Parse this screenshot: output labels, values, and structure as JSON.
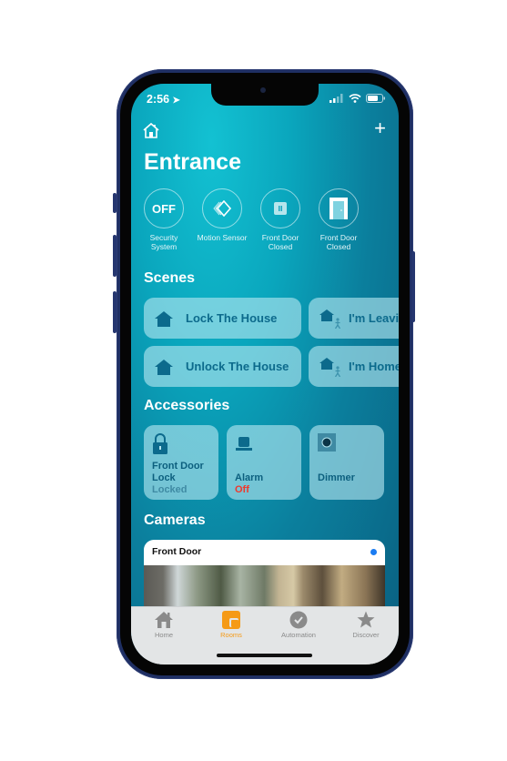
{
  "status_bar": {
    "time": "2:56"
  },
  "header": {
    "title": "Entrance",
    "home_icon": "house-outline-icon",
    "add_icon": "plus-icon"
  },
  "status_items": [
    {
      "icon_text": "OFF",
      "label_line1": "Security",
      "label_line2": "System"
    },
    {
      "icon": "motion-sensor-icon",
      "label_line1": "Motion Sensor",
      "label_line2": ""
    },
    {
      "icon": "door-closed-small-icon",
      "label_line1": "Front Door",
      "label_line2": "Closed"
    },
    {
      "icon": "door-closed-icon",
      "label_line1": "Front Door",
      "label_line2": "Closed"
    }
  ],
  "scenes": {
    "title": "Scenes",
    "items": [
      {
        "label": "Lock The House",
        "icon": "house-icon"
      },
      {
        "label": "I'm Leaving",
        "icon": "house-person-icon"
      },
      {
        "label": "Unlock The House",
        "icon": "house-icon"
      },
      {
        "label": "I'm Home",
        "icon": "house-person-icon"
      }
    ]
  },
  "accessories": {
    "title": "Accessories",
    "items": [
      {
        "name_line1": "Front Door",
        "name_line2": "Lock",
        "state": "Locked",
        "state_color": "#3f8aa3"
      },
      {
        "name_line1": "Alarm",
        "name_line2": "",
        "state": "Off",
        "state_color": "#f0372c"
      },
      {
        "name_line1": "Dimmer",
        "name_line2": "",
        "state": "",
        "state_color": "#3f8aa3"
      }
    ]
  },
  "cameras": {
    "title": "Cameras",
    "items": [
      {
        "name": "Front Door"
      }
    ]
  },
  "tabs": [
    {
      "label": "Home",
      "active": false
    },
    {
      "label": "Rooms",
      "active": true
    },
    {
      "label": "Automation",
      "active": false
    },
    {
      "label": "Discover",
      "active": false
    }
  ],
  "colors": {
    "accent": "#f59a16",
    "tile_text": "#0c6a8c",
    "alarm_off": "#f0372c",
    "camera_dot": "#1a7cf2"
  }
}
